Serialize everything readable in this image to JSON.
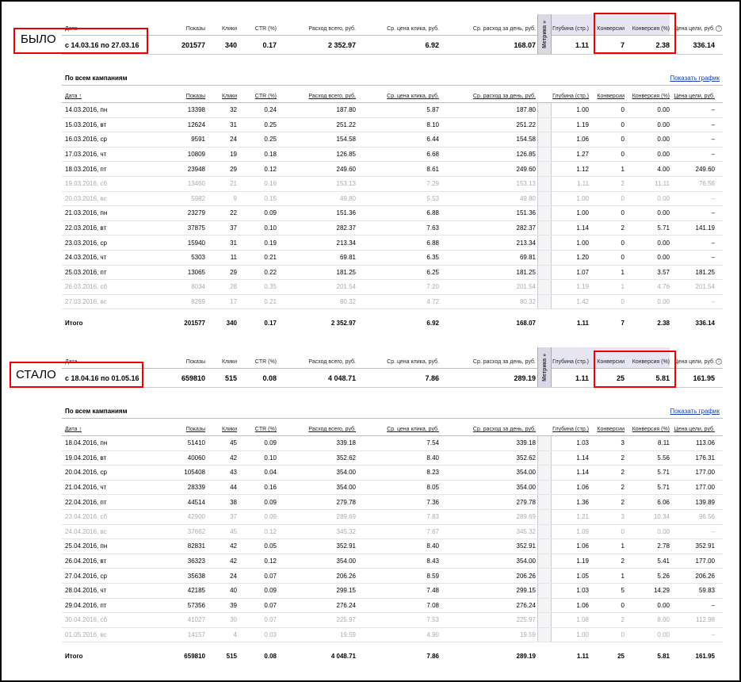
{
  "headers": {
    "date": "Дата",
    "shows": "Показы",
    "clicks": "Клики",
    "ctr": "CTR (%)",
    "spend": "Расход всего, руб.",
    "cpc": "Ср. цена клика, руб.",
    "daily": "Ср. расход за день, руб.",
    "metrika": "Метрика »",
    "depth": "Глубина (стр.)",
    "conversions": "Конверсии",
    "conv_rate": "Конверсия (%)",
    "goal_price": "Цена цели, руб."
  },
  "detail_headers": {
    "date": "Дата ↑",
    "shows": "Показы",
    "clicks": "Клики",
    "ctr": "CTR (%)",
    "spend": "Расход всего, руб.",
    "cpc": "Ср. цена клика, руб.",
    "daily": "Ср. расход за день, руб.",
    "depth": "Глубина (стр.)",
    "conversions": "Конверсии",
    "conv_rate": "Конверсия (%)",
    "goal_price": "Цена цели, руб."
  },
  "help_icon": "?",
  "all_campaigns": "По всем кампаниям",
  "show_graph": "Показать график",
  "total_label": "Итого",
  "before": {
    "label": "БЫЛО",
    "summary": {
      "date": "с 14.03.16 по 27.03.16",
      "shows": "201577",
      "clicks": "340",
      "ctr": "0.17",
      "spend": "2 352.97",
      "cpc": "6.92",
      "daily": "168.07",
      "depth": "1.11",
      "conversions": "7",
      "conv_rate": "2.38",
      "goal_price": "336.14"
    },
    "rows": [
      {
        "date": "14.03.2016, пн",
        "shows": "13398",
        "clicks": "32",
        "ctr": "0.24",
        "spend": "187.80",
        "cpc": "5.87",
        "daily": "187.80",
        "depth": "1.00",
        "conv": "0",
        "cr": "0.00",
        "goal": "–",
        "weekend": false
      },
      {
        "date": "15.03.2016, вт",
        "shows": "12624",
        "clicks": "31",
        "ctr": "0.25",
        "spend": "251.22",
        "cpc": "8.10",
        "daily": "251.22",
        "depth": "1.19",
        "conv": "0",
        "cr": "0.00",
        "goal": "–",
        "weekend": false
      },
      {
        "date": "16.03.2016, ср",
        "shows": "9591",
        "clicks": "24",
        "ctr": "0.25",
        "spend": "154.58",
        "cpc": "6.44",
        "daily": "154.58",
        "depth": "1.06",
        "conv": "0",
        "cr": "0.00",
        "goal": "–",
        "weekend": false
      },
      {
        "date": "17.03.2016, чт",
        "shows": "10809",
        "clicks": "19",
        "ctr": "0.18",
        "spend": "126.85",
        "cpc": "6.68",
        "daily": "126.85",
        "depth": "1.27",
        "conv": "0",
        "cr": "0.00",
        "goal": "–",
        "weekend": false
      },
      {
        "date": "18.03.2016, пт",
        "shows": "23948",
        "clicks": "29",
        "ctr": "0.12",
        "spend": "249.60",
        "cpc": "8.61",
        "daily": "249.60",
        "depth": "1.12",
        "conv": "1",
        "cr": "4.00",
        "goal": "249.60",
        "weekend": false
      },
      {
        "date": "19.03.2016, сб",
        "shows": "13460",
        "clicks": "21",
        "ctr": "0.16",
        "spend": "153.13",
        "cpc": "7.29",
        "daily": "153.13",
        "depth": "1.11",
        "conv": "2",
        "cr": "11.11",
        "goal": "76.56",
        "weekend": true
      },
      {
        "date": "20.03.2016, вс",
        "shows": "5982",
        "clicks": "9",
        "ctr": "0.15",
        "spend": "49.80",
        "cpc": "5.53",
        "daily": "49.80",
        "depth": "1.00",
        "conv": "0",
        "cr": "0.00",
        "goal": "–",
        "weekend": true
      },
      {
        "date": "21.03.2016, пн",
        "shows": "23279",
        "clicks": "22",
        "ctr": "0.09",
        "spend": "151.36",
        "cpc": "6.88",
        "daily": "151.36",
        "depth": "1.00",
        "conv": "0",
        "cr": "0.00",
        "goal": "–",
        "weekend": false
      },
      {
        "date": "22.03.2016, вт",
        "shows": "37875",
        "clicks": "37",
        "ctr": "0.10",
        "spend": "282.37",
        "cpc": "7.63",
        "daily": "282.37",
        "depth": "1.14",
        "conv": "2",
        "cr": "5.71",
        "goal": "141.19",
        "weekend": false
      },
      {
        "date": "23.03.2016, ср",
        "shows": "15940",
        "clicks": "31",
        "ctr": "0.19",
        "spend": "213.34",
        "cpc": "6.88",
        "daily": "213.34",
        "depth": "1.00",
        "conv": "0",
        "cr": "0.00",
        "goal": "–",
        "weekend": false
      },
      {
        "date": "24.03.2016, чт",
        "shows": "5303",
        "clicks": "11",
        "ctr": "0.21",
        "spend": "69.81",
        "cpc": "6.35",
        "daily": "69.81",
        "depth": "1.20",
        "conv": "0",
        "cr": "0.00",
        "goal": "–",
        "weekend": false
      },
      {
        "date": "25.03.2016, пт",
        "shows": "13065",
        "clicks": "29",
        "ctr": "0.22",
        "spend": "181.25",
        "cpc": "6.25",
        "daily": "181.25",
        "depth": "1.07",
        "conv": "1",
        "cr": "3.57",
        "goal": "181.25",
        "weekend": false
      },
      {
        "date": "26.03.2016, сб",
        "shows": "8034",
        "clicks": "28",
        "ctr": "0.35",
        "spend": "201.54",
        "cpc": "7.20",
        "daily": "201.54",
        "depth": "1.19",
        "conv": "1",
        "cr": "4.76",
        "goal": "201.54",
        "weekend": true
      },
      {
        "date": "27.03.2016, вс",
        "shows": "8269",
        "clicks": "17",
        "ctr": "0.21",
        "spend": "80.32",
        "cpc": "4.72",
        "daily": "80.32",
        "depth": "1.42",
        "conv": "0",
        "cr": "0.00",
        "goal": "–",
        "weekend": true
      }
    ],
    "total": {
      "shows": "201577",
      "clicks": "340",
      "ctr": "0.17",
      "spend": "2 352.97",
      "cpc": "6.92",
      "daily": "168.07",
      "depth": "1.11",
      "conv": "7",
      "cr": "2.38",
      "goal": "336.14"
    }
  },
  "after": {
    "label": "СТАЛО",
    "summary": {
      "date": "с 18.04.16 по 01.05.16",
      "shows": "659810",
      "clicks": "515",
      "ctr": "0.08",
      "spend": "4 048.71",
      "cpc": "7.86",
      "daily": "289.19",
      "depth": "1.11",
      "conversions": "25",
      "conv_rate": "5.81",
      "goal_price": "161.95"
    },
    "rows": [
      {
        "date": "18.04.2016, пн",
        "shows": "51410",
        "clicks": "45",
        "ctr": "0.09",
        "spend": "339.18",
        "cpc": "7.54",
        "daily": "339.18",
        "depth": "1.03",
        "conv": "3",
        "cr": "8.11",
        "goal": "113.06",
        "weekend": false
      },
      {
        "date": "19.04.2016, вт",
        "shows": "40060",
        "clicks": "42",
        "ctr": "0.10",
        "spend": "352.62",
        "cpc": "8.40",
        "daily": "352.62",
        "depth": "1.14",
        "conv": "2",
        "cr": "5.56",
        "goal": "176.31",
        "weekend": false
      },
      {
        "date": "20.04.2016, ср",
        "shows": "105408",
        "clicks": "43",
        "ctr": "0.04",
        "spend": "354.00",
        "cpc": "8.23",
        "daily": "354.00",
        "depth": "1.14",
        "conv": "2",
        "cr": "5.71",
        "goal": "177.00",
        "weekend": false
      },
      {
        "date": "21.04.2016, чт",
        "shows": "28339",
        "clicks": "44",
        "ctr": "0.16",
        "spend": "354.00",
        "cpc": "8.05",
        "daily": "354.00",
        "depth": "1.06",
        "conv": "2",
        "cr": "5.71",
        "goal": "177.00",
        "weekend": false
      },
      {
        "date": "22.04.2016, пт",
        "shows": "44514",
        "clicks": "38",
        "ctr": "0.09",
        "spend": "279.78",
        "cpc": "7.36",
        "daily": "279.78",
        "depth": "1.36",
        "conv": "2",
        "cr": "6.06",
        "goal": "139.89",
        "weekend": false
      },
      {
        "date": "23.04.2016, сб",
        "shows": "42900",
        "clicks": "37",
        "ctr": "0.09",
        "spend": "289.69",
        "cpc": "7.83",
        "daily": "289.69",
        "depth": "1.21",
        "conv": "3",
        "cr": "10.34",
        "goal": "96.56",
        "weekend": true
      },
      {
        "date": "24.04.2016, вс",
        "shows": "37662",
        "clicks": "45",
        "ctr": "0.12",
        "spend": "345.32",
        "cpc": "7.67",
        "daily": "345.32",
        "depth": "1.09",
        "conv": "0",
        "cr": "0.00",
        "goal": "–",
        "weekend": true
      },
      {
        "date": "25.04.2016, пн",
        "shows": "82831",
        "clicks": "42",
        "ctr": "0.05",
        "spend": "352.91",
        "cpc": "8.40",
        "daily": "352.91",
        "depth": "1.06",
        "conv": "1",
        "cr": "2.78",
        "goal": "352.91",
        "weekend": false
      },
      {
        "date": "26.04.2016, вт",
        "shows": "36323",
        "clicks": "42",
        "ctr": "0.12",
        "spend": "354.00",
        "cpc": "8.43",
        "daily": "354.00",
        "depth": "1.19",
        "conv": "2",
        "cr": "5.41",
        "goal": "177.00",
        "weekend": false
      },
      {
        "date": "27.04.2016, ср",
        "shows": "35638",
        "clicks": "24",
        "ctr": "0.07",
        "spend": "206.26",
        "cpc": "8.59",
        "daily": "206.26",
        "depth": "1.05",
        "conv": "1",
        "cr": "5.26",
        "goal": "206.26",
        "weekend": false
      },
      {
        "date": "28.04.2016, чт",
        "shows": "42185",
        "clicks": "40",
        "ctr": "0.09",
        "spend": "299.15",
        "cpc": "7.48",
        "daily": "299.15",
        "depth": "1.03",
        "conv": "5",
        "cr": "14.29",
        "goal": "59.83",
        "weekend": false
      },
      {
        "date": "29.04.2016, пт",
        "shows": "57356",
        "clicks": "39",
        "ctr": "0.07",
        "spend": "276.24",
        "cpc": "7.08",
        "daily": "276.24",
        "depth": "1.06",
        "conv": "0",
        "cr": "0.00",
        "goal": "–",
        "weekend": false
      },
      {
        "date": "30.04.2016, сб",
        "shows": "41027",
        "clicks": "30",
        "ctr": "0.07",
        "spend": "225.97",
        "cpc": "7.53",
        "daily": "225.97",
        "depth": "1.08",
        "conv": "2",
        "cr": "8.00",
        "goal": "112.98",
        "weekend": true
      },
      {
        "date": "01.05.2016, вс",
        "shows": "14157",
        "clicks": "4",
        "ctr": "0.03",
        "spend": "19.59",
        "cpc": "4.90",
        "daily": "19.59",
        "depth": "1.00",
        "conv": "0",
        "cr": "0.00",
        "goal": "–",
        "weekend": true
      }
    ],
    "total": {
      "shows": "659810",
      "clicks": "515",
      "ctr": "0.08",
      "spend": "4 048.71",
      "cpc": "7.86",
      "daily": "289.19",
      "depth": "1.11",
      "conv": "25",
      "cr": "5.81",
      "goal": "161.95"
    }
  },
  "colors": {
    "highlight": "#ee0000",
    "link": "#1a3fb0",
    "weekend_text": "#aaaaaa",
    "header_bg": "#e6e6f2"
  }
}
